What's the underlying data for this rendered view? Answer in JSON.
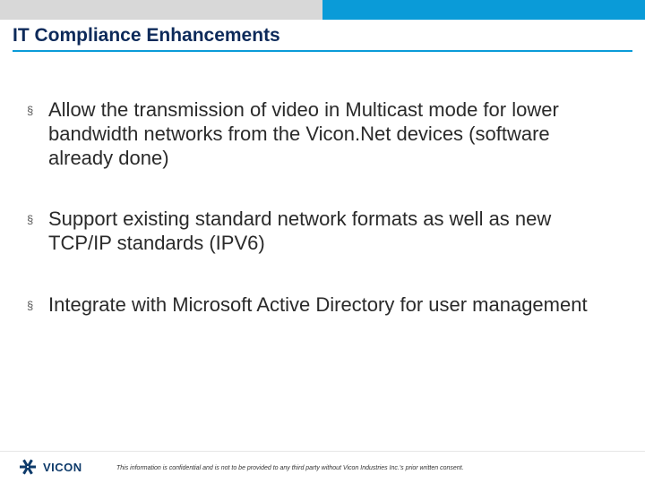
{
  "title": "IT Compliance Enhancements",
  "bullets": [
    "Allow the transmission of video in Multicast mode for lower bandwidth networks from the Vicon.Net devices (software already done)",
    "Support existing standard network formats as well as new TCP/IP standards (IPV6)",
    "Integrate with Microsoft Active Directory for user management"
  ],
  "logo_text": "VICON",
  "disclaimer": "This information is confidential and is not to be provided to any third party without Vicon Industries Inc.'s prior written consent."
}
